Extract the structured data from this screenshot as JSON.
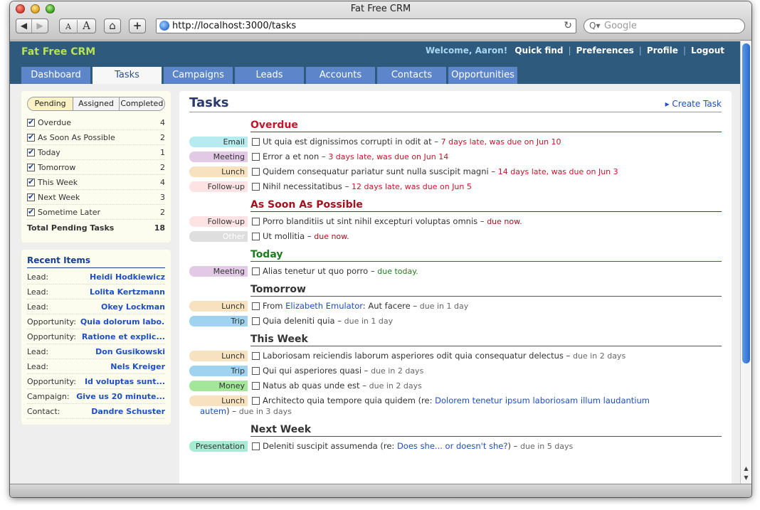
{
  "window": {
    "title": "Fat Free CRM"
  },
  "toolbar": {
    "back": "◀",
    "forward": "▶",
    "font_small": "A",
    "font_large": "A",
    "home": "⌂",
    "add": "+",
    "url": "http://localhost:3000/tasks",
    "reload": "↻",
    "search_placeholder": "Google",
    "search_icon": "Q▾"
  },
  "app": {
    "logo": "Fat Free CRM",
    "welcome": "Welcome, Aaron!",
    "links": [
      "Quick find",
      "Preferences",
      "Profile",
      "Logout"
    ],
    "tabs": [
      "Dashboard",
      "Tasks",
      "Campaigns",
      "Leads",
      "Accounts",
      "Contacts",
      "Opportunities"
    ],
    "active_tab": "Tasks"
  },
  "sidebar": {
    "views": [
      "Pending",
      "Assigned",
      "Completed"
    ],
    "selected_view": "Pending",
    "filters": [
      {
        "label": "Overdue",
        "count": "4"
      },
      {
        "label": "As Soon As Possible",
        "count": "2"
      },
      {
        "label": "Today",
        "count": "1"
      },
      {
        "label": "Tomorrow",
        "count": "2"
      },
      {
        "label": "This Week",
        "count": "4"
      },
      {
        "label": "Next Week",
        "count": "3"
      },
      {
        "label": "Sometime Later",
        "count": "2"
      }
    ],
    "total_label": "Total Pending Tasks",
    "total_count": "18",
    "recent_title": "Recent Items",
    "recent": [
      {
        "kind": "Lead:",
        "name": "Heidi Hodkiewicz"
      },
      {
        "kind": "Lead:",
        "name": "Lolita Kertzmann"
      },
      {
        "kind": "Lead:",
        "name": "Okey Lockman"
      },
      {
        "kind": "Opportunity:",
        "name": "Quia dolorum labo..."
      },
      {
        "kind": "Opportunity:",
        "name": "Ratione et explic..."
      },
      {
        "kind": "Lead:",
        "name": "Don Gusikowski"
      },
      {
        "kind": "Lead:",
        "name": "Nels Kreiger"
      },
      {
        "kind": "Opportunity:",
        "name": "Id voluptas sunt..."
      },
      {
        "kind": "Campaign:",
        "name": "Give us 20 minute..."
      },
      {
        "kind": "Contact:",
        "name": "Dandre Schuster"
      }
    ]
  },
  "main": {
    "title": "Tasks",
    "create": "▸ Create Task",
    "buckets": {
      "overdue": {
        "title": "Overdue",
        "tasks": [
          {
            "cat": "Email",
            "text": "Ut quia est dignissimos corrupti in odit at",
            "due": "7 days late, was due on Jun 10"
          },
          {
            "cat": "Meeting",
            "text": "Error a et non",
            "due": "3 days late, was due on Jun 14"
          },
          {
            "cat": "Lunch",
            "text": "Quidem consequatur pariatur sunt nulla suscipit magni",
            "due": "14 days late, was due on Jun 3"
          },
          {
            "cat": "Follow-up",
            "text": "Nihil necessitatibus",
            "due": "12 days late, was due on Jun 5"
          }
        ]
      },
      "asap": {
        "title": "As Soon As Possible",
        "tasks": [
          {
            "cat": "Follow-up",
            "text": "Porro blanditiis ut sint nihil excepturi voluptas omnis",
            "due": "due now."
          },
          {
            "cat": "Other",
            "text": "Ut mollitia",
            "due": "due now."
          }
        ]
      },
      "today": {
        "title": "Today",
        "tasks": [
          {
            "cat": "Meeting",
            "text": "Alias tenetur ut quo porro",
            "due": "due today."
          }
        ]
      },
      "tomorrow": {
        "title": "Tomorrow",
        "tasks": [
          {
            "cat": "Lunch",
            "text_pre": "From",
            "link": "Elizabeth Emulator",
            "text_post": ": Aut facere",
            "due": "due in 1 day"
          },
          {
            "cat": "Trip",
            "text": "Quia deleniti quia",
            "due": "due in 1 day"
          }
        ]
      },
      "thisweek": {
        "title": "This Week",
        "tasks": [
          {
            "cat": "Lunch",
            "text": "Laboriosam reiciendis laborum asperiores odit quia consequatur delectus",
            "due": "due in 2 days"
          },
          {
            "cat": "Trip",
            "text": "Qui qui asperiores quasi",
            "due": "due in 2 days"
          },
          {
            "cat": "Money",
            "text": "Natus ab quas unde est",
            "due": "due in 2 days"
          },
          {
            "cat": "Lunch",
            "text_pre": "Architecto quia tempore quia quidem (re:",
            "link": "Dolorem tenetur ipsum laboriosam illum laudantium",
            "link2": "autem",
            "text_post": ")",
            "due": "due in 3 days"
          }
        ]
      },
      "nextweek": {
        "title": "Next Week",
        "tasks": [
          {
            "cat": "Presentation",
            "text_pre": "Deleniti suscipit assumenda (re:",
            "link": "Does she... or doesn't she?",
            "text_post": ")",
            "due": "due in 5 days"
          }
        ]
      }
    }
  },
  "colors": {
    "header": "#2e5a7e",
    "tab": "#5c86c8",
    "overdue": "#c3162a",
    "today": "#1d7c1d",
    "link": "#1f4fc0",
    "cat_email": "#b6ecf0",
    "cat_meeting": "#e2c9e6",
    "cat_lunch": "#f6e2bf",
    "cat_followup": "#fde3e3",
    "cat_other": "#dedede",
    "cat_trip": "#9fd3ef",
    "cat_money": "#a4e79a",
    "cat_presentation": "#a6ecd2"
  }
}
